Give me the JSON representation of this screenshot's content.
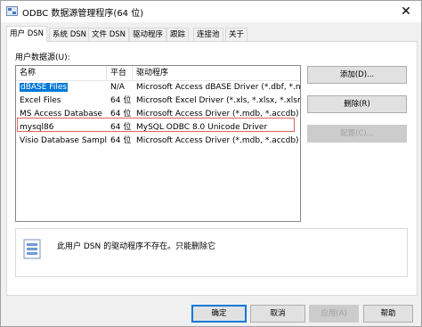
{
  "window": {
    "title": "ODBC 数据源管理程序(64 位)",
    "close": "✕"
  },
  "tabs": [
    {
      "label": "用户 DSN"
    },
    {
      "label": "系统 DSN"
    },
    {
      "label": "文件 DSN"
    },
    {
      "label": "驱动程序"
    },
    {
      "label": "跟踪"
    },
    {
      "label": "连接池"
    },
    {
      "label": "关于"
    }
  ],
  "user_dsn": {
    "group_label": "用户数据源(U):",
    "columns": [
      "名称",
      "平台",
      "驱动程序"
    ],
    "rows": [
      {
        "name": "dBASE Files",
        "platform": "N/A",
        "driver": "Microsoft Access dBASE Driver (*.dbf, *.ndx, *"
      },
      {
        "name": "Excel Files",
        "platform": "64 位",
        "driver": "Microsoft Excel Driver (*.xls, *.xlsx, *.xlsm, *.xls"
      },
      {
        "name": "MS Access Database",
        "platform": "64 位",
        "driver": "Microsoft Access Driver (*.mdb, *.accdb)"
      },
      {
        "name": "mysql86",
        "platform": "64 位",
        "driver": "MySQL ODBC 8.0 Unicode Driver"
      },
      {
        "name": "Visio Database Samples",
        "platform": "64 位",
        "driver": "Microsoft Access Driver (*.mdb, *.accdb)"
      }
    ],
    "selected_row": "dBASE Files",
    "buttons": {
      "add": "添加(D)...",
      "remove": "删除(R)",
      "configure": "配置(C)..."
    },
    "info_text": "此用户 DSN 的驱动程序不存在。只能删除它"
  },
  "footer": {
    "ok": "确定",
    "cancel": "取消",
    "apply": "应用(A)",
    "help": "帮助"
  },
  "colors": {
    "selection": "#0078d7",
    "highlight_border": "#e06060"
  }
}
